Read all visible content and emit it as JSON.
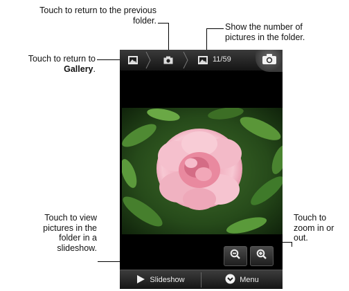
{
  "annotations": {
    "prev_folder": "Touch to return to the previous folder.",
    "gallery_line1": "Touch to return to",
    "gallery_bold": "Gallery",
    "gallery_period": ".",
    "count_info": "Show the number of pictures in the folder.",
    "slideshow_info": "Touch to view pictures in the folder in a slideshow.",
    "zoom_info": "Touch to zoom in or out."
  },
  "phone": {
    "counter": "11/59",
    "slideshow_label": "Slideshow",
    "menu_label": "Menu"
  },
  "icons": {
    "gallery": "picture-icon",
    "folder": "camera-icon",
    "current": "picture-icon",
    "camera": "camera-icon",
    "zoom_out": "zoom-out-icon",
    "zoom_in": "zoom-in-icon",
    "slideshow": "play-arrow-icon",
    "menu": "menu-circle-icon"
  },
  "colors": {
    "screen_bg": "#000000",
    "bar_text": "#f0f0f0"
  }
}
